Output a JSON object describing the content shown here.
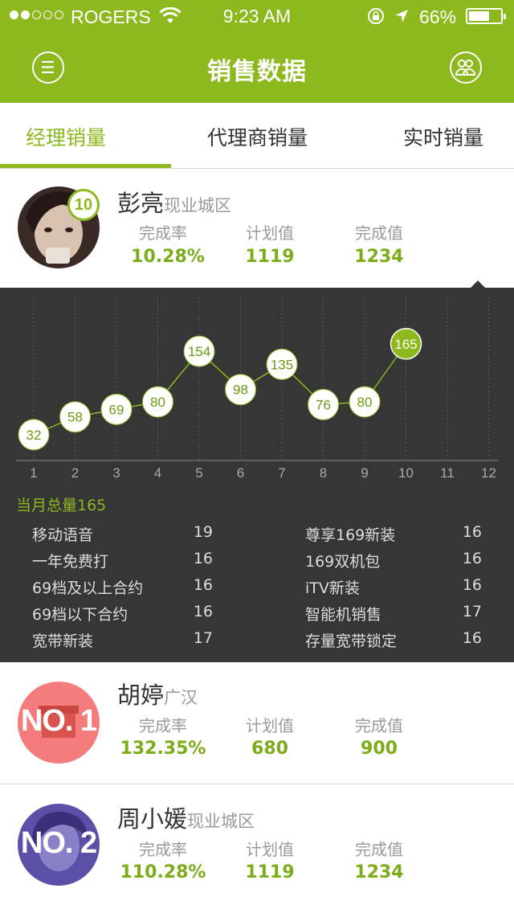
{
  "status_bar": {
    "carrier": "ROGERS",
    "time": "9:23 AM",
    "battery": "66%",
    "battery_level": 0.66,
    "signal_bars": 2
  },
  "nav": {
    "title": "销售数据",
    "menu_icon": "menu-icon",
    "people_icon": "people-icon"
  },
  "tabs": [
    {
      "label": "经理销量",
      "active": true
    },
    {
      "label": "代理商销量",
      "active": false
    },
    {
      "label": "实时销量",
      "active": false
    }
  ],
  "colors": {
    "accent": "#8db81e",
    "value_green": "#7cac1a",
    "panel_bg": "#363636",
    "rank1": "#f47c7c",
    "rank2": "#5b4fa8"
  },
  "people": [
    {
      "name": "彭亮",
      "region": "现业城区",
      "rank": "10",
      "labels": [
        "完成率",
        "计划值",
        "完成值"
      ],
      "values": [
        "10.28%",
        "1119",
        "1234"
      ]
    },
    {
      "name": "胡婷",
      "region": "广汉",
      "rank": "NO. 1",
      "labels": [
        "完成率",
        "计划值",
        "完成值"
      ],
      "values": [
        "132.35%",
        "680",
        "900"
      ]
    },
    {
      "name": "周小媛",
      "region": "现业城区",
      "rank": "NO. 2",
      "labels": [
        "完成率",
        "计划值",
        "完成值"
      ],
      "values": [
        "110.28%",
        "1119",
        "1234"
      ]
    }
  ],
  "chart_data": {
    "type": "line",
    "x": [
      1,
      2,
      3,
      4,
      5,
      6,
      7,
      8,
      9,
      10,
      11,
      12
    ],
    "categories": [
      "1",
      "2",
      "3",
      "4",
      "5",
      "6",
      "7",
      "8",
      "9",
      "10",
      "11",
      "12"
    ],
    "series": [
      {
        "values": [
          32,
          58,
          69,
          80,
          154,
          98,
          135,
          76,
          80,
          165,
          null,
          null
        ]
      }
    ],
    "highlight_index": 9,
    "ylim": [
      0,
      200
    ],
    "grid": true
  },
  "monthly": {
    "total_label": "当月总量165",
    "items": [
      {
        "name": "移动语音",
        "value": "19"
      },
      {
        "name": "尊享169新装",
        "value": "16"
      },
      {
        "name": "一年免费打",
        "value": "16"
      },
      {
        "name": "169双机包",
        "value": "16"
      },
      {
        "name": "69档及以上合约",
        "value": "16"
      },
      {
        "name": "iTV新装",
        "value": "16"
      },
      {
        "name": "69档以下合约",
        "value": "16"
      },
      {
        "name": "智能机销售",
        "value": "17"
      },
      {
        "name": "宽带新装",
        "value": "17"
      },
      {
        "name": "存量宽带锁定",
        "value": "16"
      }
    ]
  }
}
